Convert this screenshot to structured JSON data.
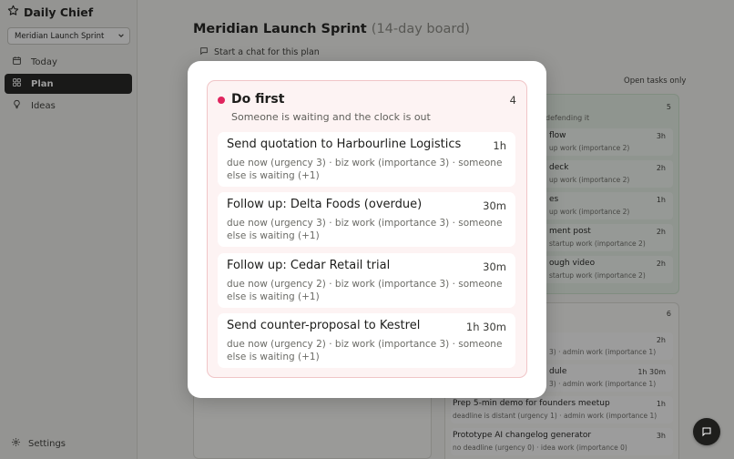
{
  "app": {
    "name": "Daily Chief"
  },
  "sidebar": {
    "plan_select": {
      "value": "Meridian Launch Sprint"
    },
    "items": [
      {
        "label": "Today",
        "icon": "calendar-icon"
      },
      {
        "label": "Plan",
        "icon": "grid-icon",
        "active": true
      },
      {
        "label": "Ideas",
        "icon": "lightbulb-icon"
      }
    ],
    "settings_label": "Settings"
  },
  "main": {
    "title": "Meridian Launch Sprint",
    "title_sub": "(14-day board)",
    "chat_link": "Start a chat for this plan",
    "open_only_label": "Open tasks only",
    "quadrant_a": {
      "count": "5",
      "desc_visible": "defending it",
      "tasks": [
        {
          "title_visible": "flow",
          "meta_visible": "up work (importance 2)",
          "duration": "3h"
        },
        {
          "title_visible": "deck",
          "meta_visible": "up work (importance 2)",
          "duration": "2h"
        },
        {
          "title_visible": "es",
          "meta_visible": "up work (importance 2)",
          "duration": "1h"
        },
        {
          "title_visible": "ment post",
          "meta_visible": "startup work (importance 2)",
          "duration": "2h"
        },
        {
          "title_visible": "ough video",
          "meta_visible": "startup work (importance 2)",
          "duration": "2h"
        }
      ]
    },
    "quadrant_b": {
      "count": "6",
      "tasks": [
        {
          "title_visible": "",
          "meta_visible": "3) · admin work (importance 1)",
          "duration": "2h"
        },
        {
          "title_visible": "dule",
          "meta_visible": "3) · admin work (importance 1)",
          "duration": "1h 30m"
        },
        {
          "title_visible": "Prep 5-min demo for founders meetup",
          "meta_visible": "deadline is distant (urgency 1) · admin work (importance 1)",
          "duration": "1h"
        },
        {
          "title_visible": "Prototype AI changelog generator",
          "meta_visible": "no deadline (urgency 0) · idea work (importance 0)",
          "duration": "3h"
        }
      ]
    }
  },
  "modal": {
    "title": "Do first",
    "count": "4",
    "subtitle": "Someone is waiting and the clock is out",
    "accent_color": "#e0245e",
    "tasks": [
      {
        "title": "Send quotation to Harbourline Logistics",
        "duration": "1h",
        "meta": "due now (urgency 3) · biz work (importance 3) · someone else is waiting (+1)"
      },
      {
        "title": "Follow up: Delta Foods (overdue)",
        "duration": "30m",
        "meta": "due now (urgency 3) · biz work (importance 3) · someone else is waiting (+1)"
      },
      {
        "title": "Follow up: Cedar Retail trial",
        "duration": "30m",
        "meta": "due now (urgency 2) · biz work (importance 3) · someone else is waiting (+1)"
      },
      {
        "title": "Send counter-proposal to Kestrel",
        "duration": "1h 30m",
        "meta": "due now (urgency 2) · biz work (importance 3) · someone else is waiting (+1)"
      }
    ]
  }
}
